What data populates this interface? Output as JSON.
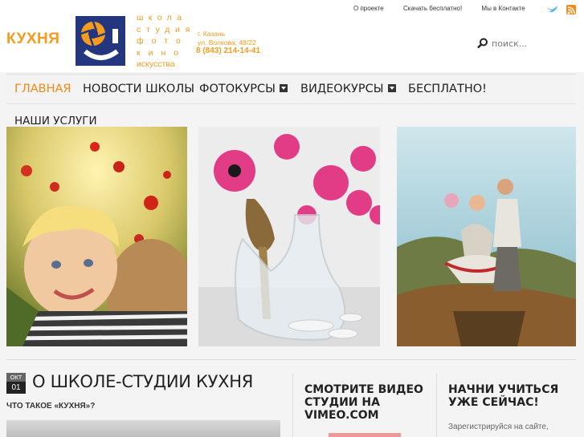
{
  "brand": {
    "word": "КУХНЯ",
    "logo_lines": [
      "школа",
      "студия",
      "фото",
      "кино",
      "искусства"
    ],
    "address_city": "г. Казань",
    "address_street": "ул. Волкова, 48/22",
    "phone": "8 (843) 214-14-41"
  },
  "toplinks": [
    "О проекте",
    "Скачать бесплатно!",
    "Мы в Контакте"
  ],
  "search": {
    "placeholder": "поиск..."
  },
  "nav": {
    "items": [
      {
        "label": "ГЛАВНАЯ",
        "active": true,
        "dropdown": false
      },
      {
        "label": "НОВОСТИ ШКОЛЫ",
        "active": false,
        "dropdown": false
      },
      {
        "label": "ФОТОКУРСЫ",
        "active": false,
        "dropdown": true
      },
      {
        "label": "ВИДЕОКУРСЫ",
        "active": false,
        "dropdown": true
      },
      {
        "label": "БЕСПЛАТНО!",
        "active": false,
        "dropdown": false
      }
    ],
    "services_label": "НАШИ УСЛУГИ"
  },
  "post": {
    "date_month": "ОКТ",
    "date_day": "01",
    "title": "О ШКОЛЕ-СТУДИИ КУХНЯ",
    "subtitle": "ЧТО ТАКОЕ «КУХНЯ»?"
  },
  "widgets": {
    "video": {
      "title_lines": [
        "СМОТРИТЕ ВИДЕО",
        "СТУДИИ НА",
        "VIMEO.COM"
      ]
    },
    "start": {
      "title_lines": [
        "НАЧНИ УЧИТЬСЯ",
        "УЖЕ СЕЙЧАС!"
      ],
      "text": "Зарегистрируйся на сайте,"
    }
  },
  "colors": {
    "accent": "#f08a15",
    "logo_bg": "#24367d"
  }
}
